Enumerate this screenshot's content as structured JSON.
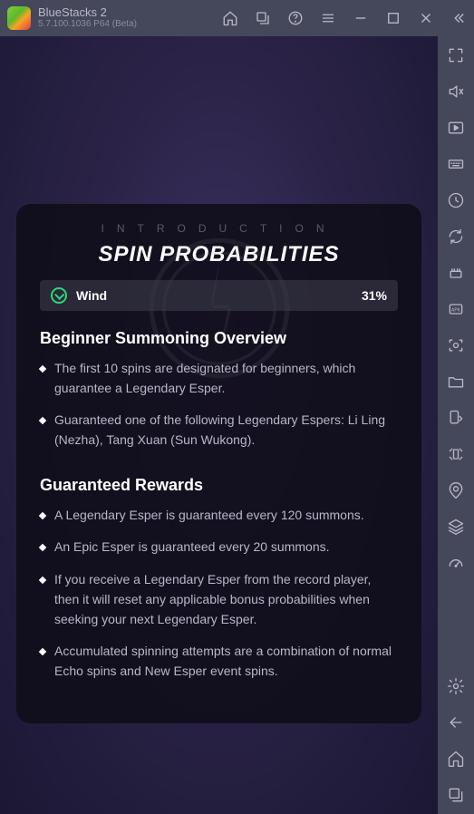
{
  "app": {
    "name": "BlueStacks 2",
    "version": "5.7.100.1036   P64 (Beta)"
  },
  "modal": {
    "intro": "INTRODUCTION",
    "title": "SPIN PROBABILITIES",
    "row": {
      "element": "Wind",
      "value": "31%"
    },
    "section1": {
      "title": "Beginner Summoning Overview",
      "items": [
        "The first 10 spins are designated for beginners, which guarantee a Legendary Esper.",
        "Guaranteed one of the following Legendary Espers: Li Ling (Nezha), Tang Xuan (Sun Wukong)."
      ]
    },
    "section2": {
      "title": "Guaranteed Rewards",
      "items": [
        "A Legendary Esper is guaranteed every 120 summons.",
        "An Epic Esper is guaranteed every 20 summons.",
        "If you receive a Legendary Esper from the record player, then it will reset any applicable bonus probabilities when seeking your next Legendary Esper.",
        "Accumulated spinning attempts are a combination of normal Echo spins and New Esper event spins."
      ]
    }
  }
}
